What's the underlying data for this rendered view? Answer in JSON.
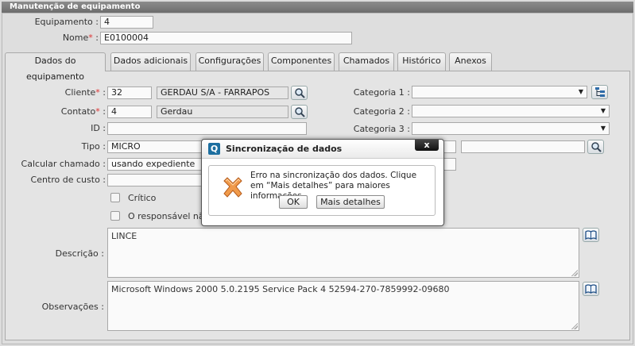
{
  "window": {
    "title": "Manutenção de equipamento"
  },
  "header": {
    "equipamento_label": "Equipamento :",
    "equipamento_value": "4",
    "nome_label": "Nome",
    "nome_sep": ":",
    "nome_value": "E0100004"
  },
  "tabs": [
    {
      "label": "Dados do equipamento"
    },
    {
      "label": "Dados adicionais"
    },
    {
      "label": "Configurações"
    },
    {
      "label": "Componentes"
    },
    {
      "label": "Chamados"
    },
    {
      "label": "Histórico"
    },
    {
      "label": "Anexos"
    }
  ],
  "form": {
    "cliente_label": "Cliente",
    "cliente_code": "32",
    "cliente_name": "GERDAU S/A - FARRAPOS",
    "contato_label": "Contato",
    "contato_code": "4",
    "contato_name": "Gerdau",
    "id_label": "ID :",
    "id_value": "",
    "tipo_label": "Tipo :",
    "tipo_value": "MICRO",
    "calcular_label": "Calcular chamado :",
    "calcular_value": "usando expediente",
    "centro_label": "Centro de custo :",
    "centro_value": "",
    "critico_label": "Crítico",
    "responsavel_label": "O responsável não",
    "descricao_label": "Descrição :",
    "descricao_value": "LINCE",
    "observacoes_label": "Observações :",
    "observacoes_value": "Microsoft Windows 2000 5.0.2195 Service Pack 4 52594-270-7859992-09680",
    "categoria1_label": "Categoria 1 :",
    "categoria2_label": "Categoria 2 :",
    "categoria3_label": "Categoria 3 :",
    "categoria1_value": "",
    "categoria2_value": "",
    "categoria3_value": "",
    "sep": ":"
  },
  "dialog": {
    "title": "Sincronização de dados",
    "close_label": "x",
    "message": "Erro na sincronização dos dados. Clique em “Mais detalhes” para maiores informações.",
    "ok_label": "OK",
    "details_label": "Mais detalhes",
    "logo_glyph": "Q"
  },
  "icons": {
    "search": "search-icon",
    "tree": "tree-icon",
    "book": "book-icon",
    "error": "error-x-icon"
  },
  "colors": {
    "required": "#dd3333",
    "titlebar": "#7a7a7a",
    "logo": "#1d6fa0",
    "error_x": "#e07a2a"
  }
}
